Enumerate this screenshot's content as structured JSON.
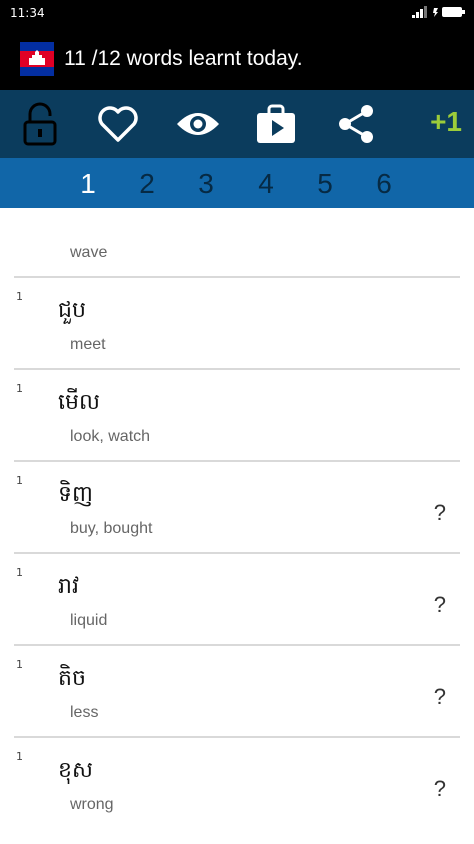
{
  "status_bar": {
    "time": "11:34"
  },
  "header": {
    "title": "11 /12 words learnt today."
  },
  "toolbar": {
    "icons": [
      "lock-open-icon",
      "heart-icon",
      "eye-icon",
      "play-store-icon",
      "share-icon"
    ],
    "plus_label": "+1",
    "plus_color": "#9ccc3a"
  },
  "tabs": [
    "1",
    "2",
    "3",
    "4",
    "5",
    "6"
  ],
  "active_tab": "1",
  "words": [
    {
      "num": "",
      "word": "",
      "meaning": "wave",
      "question": ""
    },
    {
      "num": "1",
      "word": "ជួប",
      "meaning": "meet",
      "question": ""
    },
    {
      "num": "1",
      "word": "មើល",
      "meaning": "look, watch",
      "question": ""
    },
    {
      "num": "1",
      "word": "ទិញ",
      "meaning": "buy, bought",
      "question": "?"
    },
    {
      "num": "1",
      "word": "រាវ",
      "meaning": "liquid",
      "question": "?"
    },
    {
      "num": "1",
      "word": "តិច",
      "meaning": "less",
      "question": "?"
    },
    {
      "num": "1",
      "word": "ខុស",
      "meaning": "wrong",
      "question": "?"
    }
  ],
  "colors": {
    "toolbar_bg": "#0b3c5d",
    "tabs_bg": "#1166a8"
  }
}
